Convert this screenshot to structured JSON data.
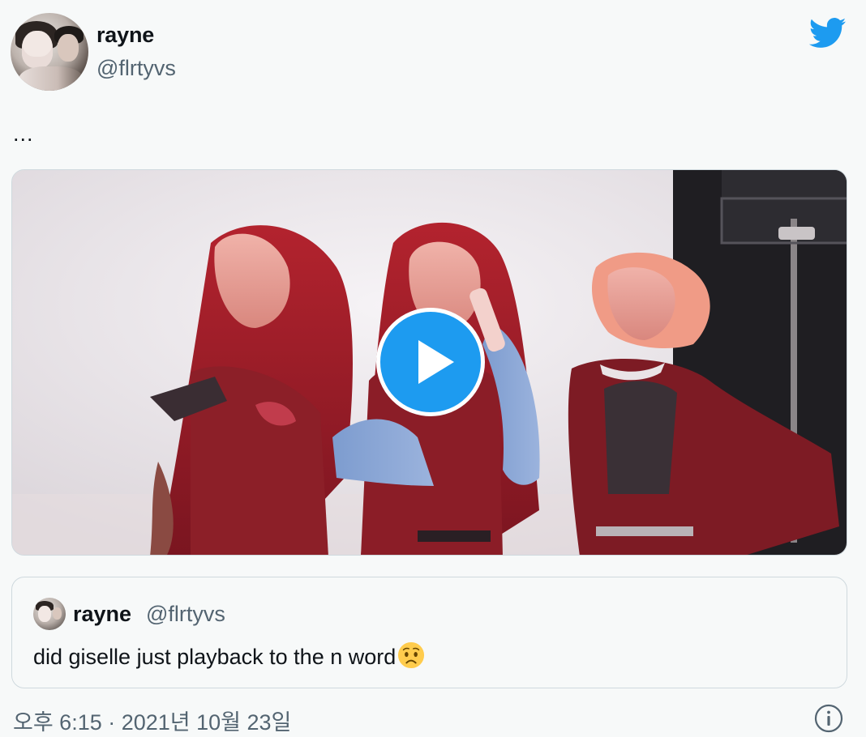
{
  "author": {
    "display_name": "rayne",
    "handle": "@flrtyvs",
    "avatar": "profile-photo"
  },
  "brand_icon": "twitter-bird-icon",
  "tweet": {
    "text": "..."
  },
  "media": {
    "type": "video",
    "thumbnail": "three-performers-red-lighting",
    "play_icon": "play-icon"
  },
  "quoted_tweet": {
    "display_name": "rayne",
    "handle": "@flrtyvs",
    "text": "did giselle just playback to the n word",
    "emoji": "worried-face-emoji"
  },
  "footer": {
    "timestamp": "오후 6:15 · 2021년 10월 23일",
    "info_icon": "info-icon"
  },
  "colors": {
    "accent": "#1d9bf0",
    "text_primary": "#0f1419",
    "text_secondary": "#536471",
    "border": "#cfd9de",
    "background": "#f7f9f9"
  }
}
